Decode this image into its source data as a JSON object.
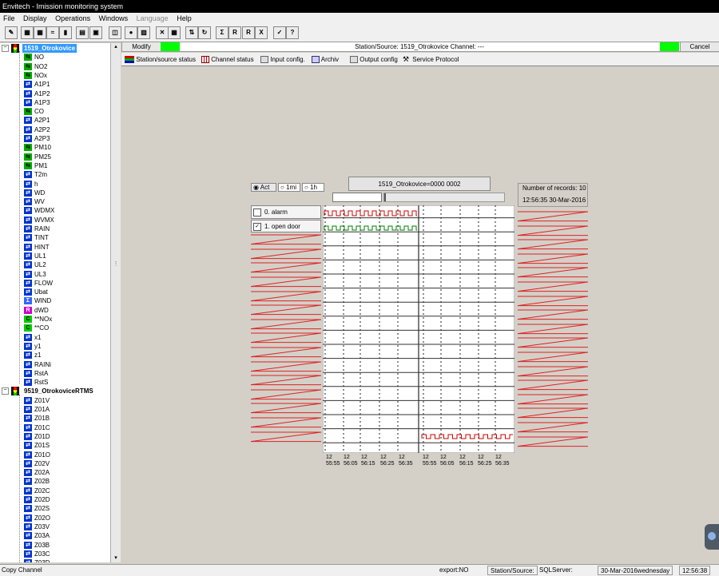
{
  "app": {
    "title": "Envitech - Imission  monitoring system"
  },
  "menu": {
    "items": [
      {
        "label": "File",
        "enabled": true
      },
      {
        "label": "Display",
        "enabled": true
      },
      {
        "label": "Operations",
        "enabled": true
      },
      {
        "label": "Windows",
        "enabled": true
      },
      {
        "label": "Language",
        "enabled": false
      },
      {
        "label": "Help",
        "enabled": true
      }
    ]
  },
  "toolbar": {
    "buttons": [
      {
        "icon": "pen-icon",
        "glyph": "✎"
      },
      {
        "icon": "station-grid-icon",
        "glyph": "▦"
      },
      {
        "icon": "station-edit-icon",
        "glyph": "▦"
      },
      {
        "icon": "wave-icon",
        "glyph": "≈"
      },
      {
        "icon": "bar-chart-icon",
        "glyph": "▮"
      },
      {
        "icon": "report-icon",
        "glyph": "▤"
      },
      {
        "icon": "print-preview-icon",
        "glyph": "▣"
      },
      {
        "icon": "basket-icon",
        "glyph": "◫"
      },
      {
        "icon": "traffic-light-icon",
        "glyph": "●"
      },
      {
        "icon": "chart-export-icon",
        "glyph": "▨"
      },
      {
        "icon": "cross-icon",
        "glyph": "✕"
      },
      {
        "icon": "grid-icon",
        "glyph": "▦"
      },
      {
        "icon": "arrows-icon",
        "glyph": "⇅"
      },
      {
        "icon": "cycle-icon",
        "glyph": "↻"
      },
      {
        "icon": "sigma-icon",
        "glyph": "Σ"
      },
      {
        "icon": "r-icon",
        "glyph": "R"
      },
      {
        "icon": "r-chart-icon",
        "glyph": "R"
      },
      {
        "icon": "x-chart-icon",
        "glyph": "X"
      },
      {
        "icon": "checklist-icon",
        "glyph": "✓"
      },
      {
        "icon": "help-icon",
        "glyph": "?"
      }
    ]
  },
  "tree": {
    "station1": {
      "label": "1519_Otrokovice"
    },
    "station1_channels": [
      {
        "label": "NO",
        "type": "green"
      },
      {
        "label": "NO2",
        "type": "green"
      },
      {
        "label": "NOx",
        "type": "green"
      },
      {
        "label": "A1P1",
        "type": "blue"
      },
      {
        "label": "A1P2",
        "type": "blue"
      },
      {
        "label": "A1P3",
        "type": "blue"
      },
      {
        "label": "CO",
        "type": "green"
      },
      {
        "label": "A2P1",
        "type": "blue"
      },
      {
        "label": "A2P2",
        "type": "blue"
      },
      {
        "label": "A2P3",
        "type": "blue"
      },
      {
        "label": "PM10",
        "type": "green"
      },
      {
        "label": "PM25",
        "type": "green"
      },
      {
        "label": "PM1",
        "type": "green"
      },
      {
        "label": "T2m",
        "type": "blue"
      },
      {
        "label": "h",
        "type": "blue"
      },
      {
        "label": "WD",
        "type": "blue"
      },
      {
        "label": "WV",
        "type": "blue"
      },
      {
        "label": "WDMX",
        "type": "blue"
      },
      {
        "label": "WVMX",
        "type": "blue"
      },
      {
        "label": "RAIN",
        "type": "blue"
      },
      {
        "label": "TINT",
        "type": "blue"
      },
      {
        "label": "HINT",
        "type": "blue"
      },
      {
        "label": "UL1",
        "type": "blue"
      },
      {
        "label": "UL2",
        "type": "blue"
      },
      {
        "label": "UL3",
        "type": "blue"
      },
      {
        "label": "FLOW",
        "type": "blue"
      },
      {
        "label": "Ubat",
        "type": "blue"
      },
      {
        "label": "WIND",
        "type": "sigma"
      },
      {
        "label": "dWD",
        "type": "r"
      },
      {
        "label": "**NOx",
        "type": "c"
      },
      {
        "label": "**CO",
        "type": "c"
      },
      {
        "label": "x1",
        "type": "blue"
      },
      {
        "label": "y1",
        "type": "blue"
      },
      {
        "label": "z1",
        "type": "blue"
      },
      {
        "label": "RAINi",
        "type": "blue"
      },
      {
        "label": "RstA",
        "type": "blue"
      },
      {
        "label": "RstS",
        "type": "blue"
      }
    ],
    "station2": {
      "label": "9519_OtrokoviceRTMS"
    },
    "station2_channels": [
      {
        "label": "Z01V"
      },
      {
        "label": "Z01A"
      },
      {
        "label": "Z01B"
      },
      {
        "label": "Z01C"
      },
      {
        "label": "Z01D"
      },
      {
        "label": "Z01S"
      },
      {
        "label": "Z01O"
      },
      {
        "label": "Z02V"
      },
      {
        "label": "Z02A"
      },
      {
        "label": "Z02B"
      },
      {
        "label": "Z02C"
      },
      {
        "label": "Z02D"
      },
      {
        "label": "Z02S"
      },
      {
        "label": "Z02O"
      },
      {
        "label": "Z03V"
      },
      {
        "label": "Z03A"
      },
      {
        "label": "Z03B"
      },
      {
        "label": "Z03C"
      },
      {
        "label": "Z03D"
      }
    ]
  },
  "header": {
    "modify_label": "Modify",
    "station_text": "Station/Source: 1519_Otrokovice   Channel: ---",
    "cancel_label": "Cancel",
    "indicator_color": "#00ff00"
  },
  "tabs": [
    {
      "label": "Station/source status",
      "icon": "status-icon"
    },
    {
      "label": "Channel status",
      "icon": "grid-icon"
    },
    {
      "label": "Input config.",
      "icon": "input-icon"
    },
    {
      "label": "Archiv",
      "icon": "archive-icon"
    },
    {
      "label": "Output config",
      "icon": "output-icon"
    },
    {
      "label": "Service Protocol",
      "icon": "tools-icon"
    }
  ],
  "monitor": {
    "radio_options": [
      {
        "label": "Act",
        "selected": true
      },
      {
        "label": "1mi",
        "selected": false
      },
      {
        "label": "1h",
        "selected": false
      }
    ],
    "station_code": "1519_Otrokovice=0000  0002",
    "records_label": "Number of records:  10",
    "timestamp": "12:56:35  30-Mar-2016",
    "channels": [
      {
        "label": "0. alarm",
        "checked": false
      },
      {
        "label": "1. open door",
        "checked": true
      }
    ],
    "time_ticks": [
      "12\n55:55",
      "12\n56:05",
      "12\n56:15",
      "12\n56:25",
      "12\n56:35"
    ],
    "signal_colors": {
      "alarm": "#cc0000",
      "door": "#008000",
      "empty": "#dd2222"
    }
  },
  "statusbar": {
    "left": "Copy Channel",
    "export": "export:NO",
    "station_source": "Station/Source:",
    "sql": "SQLServer:",
    "date": "30-Mar-2016wednesday",
    "time": "12:56:38"
  }
}
